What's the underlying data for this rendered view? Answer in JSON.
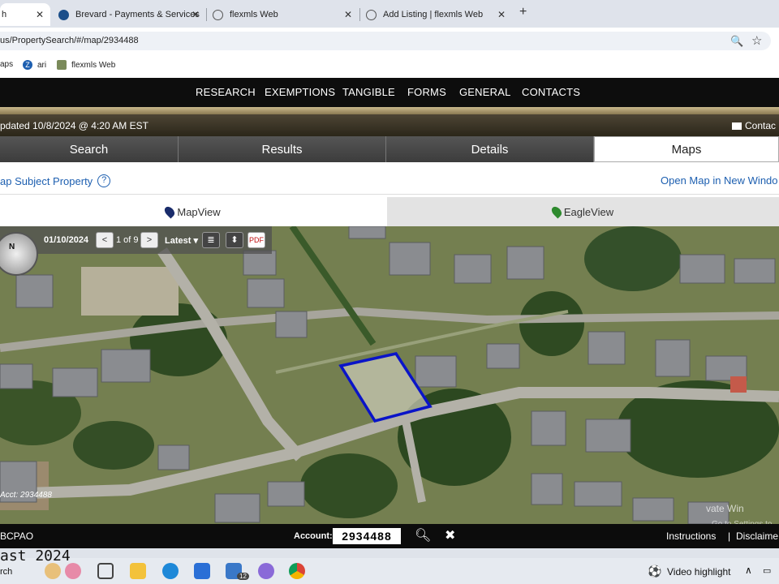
{
  "browser": {
    "tabs": [
      {
        "title": "h"
      },
      {
        "title": "Brevard - Payments & Services"
      },
      {
        "title": "flexmls Web"
      },
      {
        "title": "Add Listing | flexmls Web"
      }
    ],
    "new_tab": "+",
    "url": "us/PropertySearch/#/map/2934488",
    "bookmarks": [
      "aps",
      "ari",
      "flexmls Web"
    ]
  },
  "site_nav": [
    "RESEARCH",
    "EXEMPTIONS",
    "TANGIBLE",
    "FORMS",
    "GENERAL",
    "CONTACTS"
  ],
  "update_bar": {
    "text": "pdated 10/8/2024 @ 4:20 AM EST",
    "contact": "Contac"
  },
  "main_tabs": [
    "Search",
    "Results",
    "Details",
    "Maps"
  ],
  "subject": {
    "label": "ap Subject Property",
    "help": "?",
    "open_map": "Open Map in New Windo"
  },
  "view_tabs": [
    "MapView",
    "EagleView"
  ],
  "map": {
    "date": "01/10/2024",
    "prev": "<",
    "page": "1 of 9",
    "next": ">",
    "latest": "Latest",
    "compass": "N",
    "account_overlay": "Acct: 2934488",
    "watermark": "vate Win",
    "watermark_sub": "Go to Settings to"
  },
  "footer": {
    "org": "BCPAO",
    "account_label": "Account:",
    "account_value": "2934488",
    "instructions": "Instructions",
    "separator": "|",
    "disclaimer": "Disclaime"
  },
  "taskbar": {
    "east_text": "ast 2024",
    "search": "rch",
    "video": "Video highlight",
    "notif_count": "12"
  },
  "colors": {
    "nav_bg": "#0d0d0d",
    "link": "#1d5fb0",
    "parcel": "#0a14c8"
  }
}
